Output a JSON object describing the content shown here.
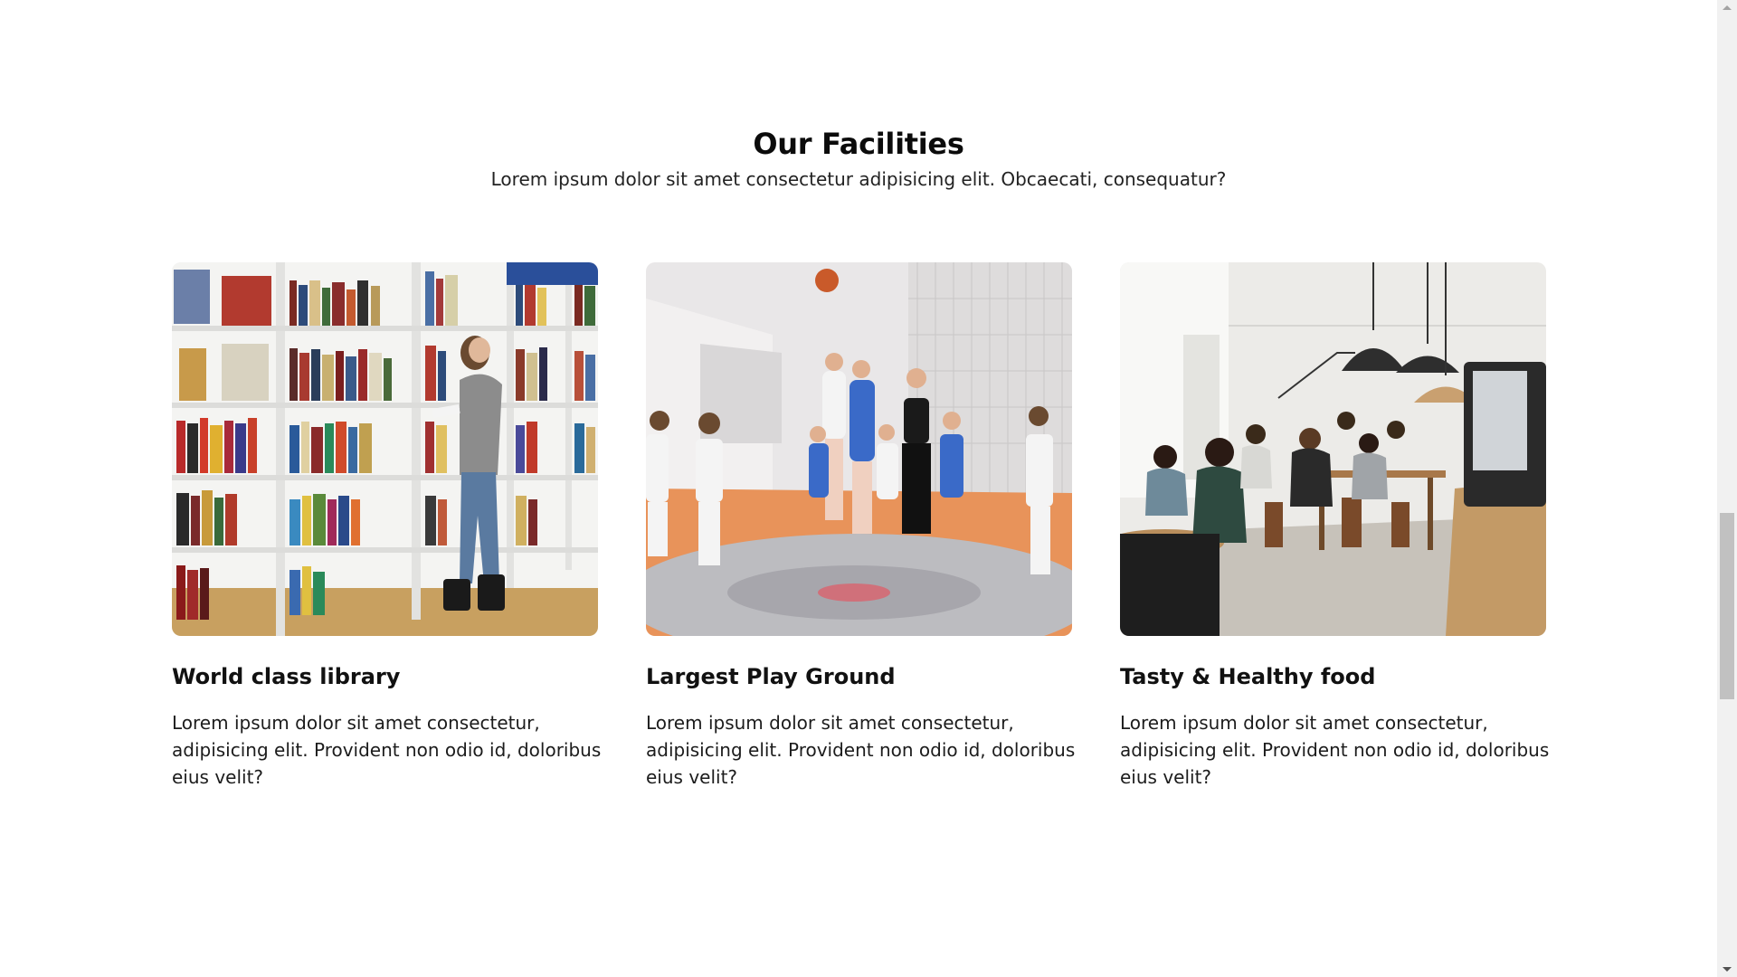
{
  "section": {
    "title": "Our Facilities",
    "subtitle": "Lorem ipsum dolor sit amet consectetur adipisicing elit. Obcaecati, consequatur?"
  },
  "cards": [
    {
      "title": "World class library",
      "text": "Lorem ipsum dolor sit amet consectetur, adipisicing elit. Provident non odio id, doloribus eius velit?",
      "image": "library-photo"
    },
    {
      "title": "Largest Play Ground",
      "text": "Lorem ipsum dolor sit amet consectetur, adipisicing elit. Provident non odio id, doloribus eius velit?",
      "image": "basketball-court-photo"
    },
    {
      "title": "Tasty & Healthy food",
      "text": "Lorem ipsum dolor sit amet consectetur, adipisicing elit. Provident non odio id, doloribus eius velit?",
      "image": "cafeteria-photo"
    }
  ],
  "scrollbar": {
    "position_fraction": 0.53
  }
}
